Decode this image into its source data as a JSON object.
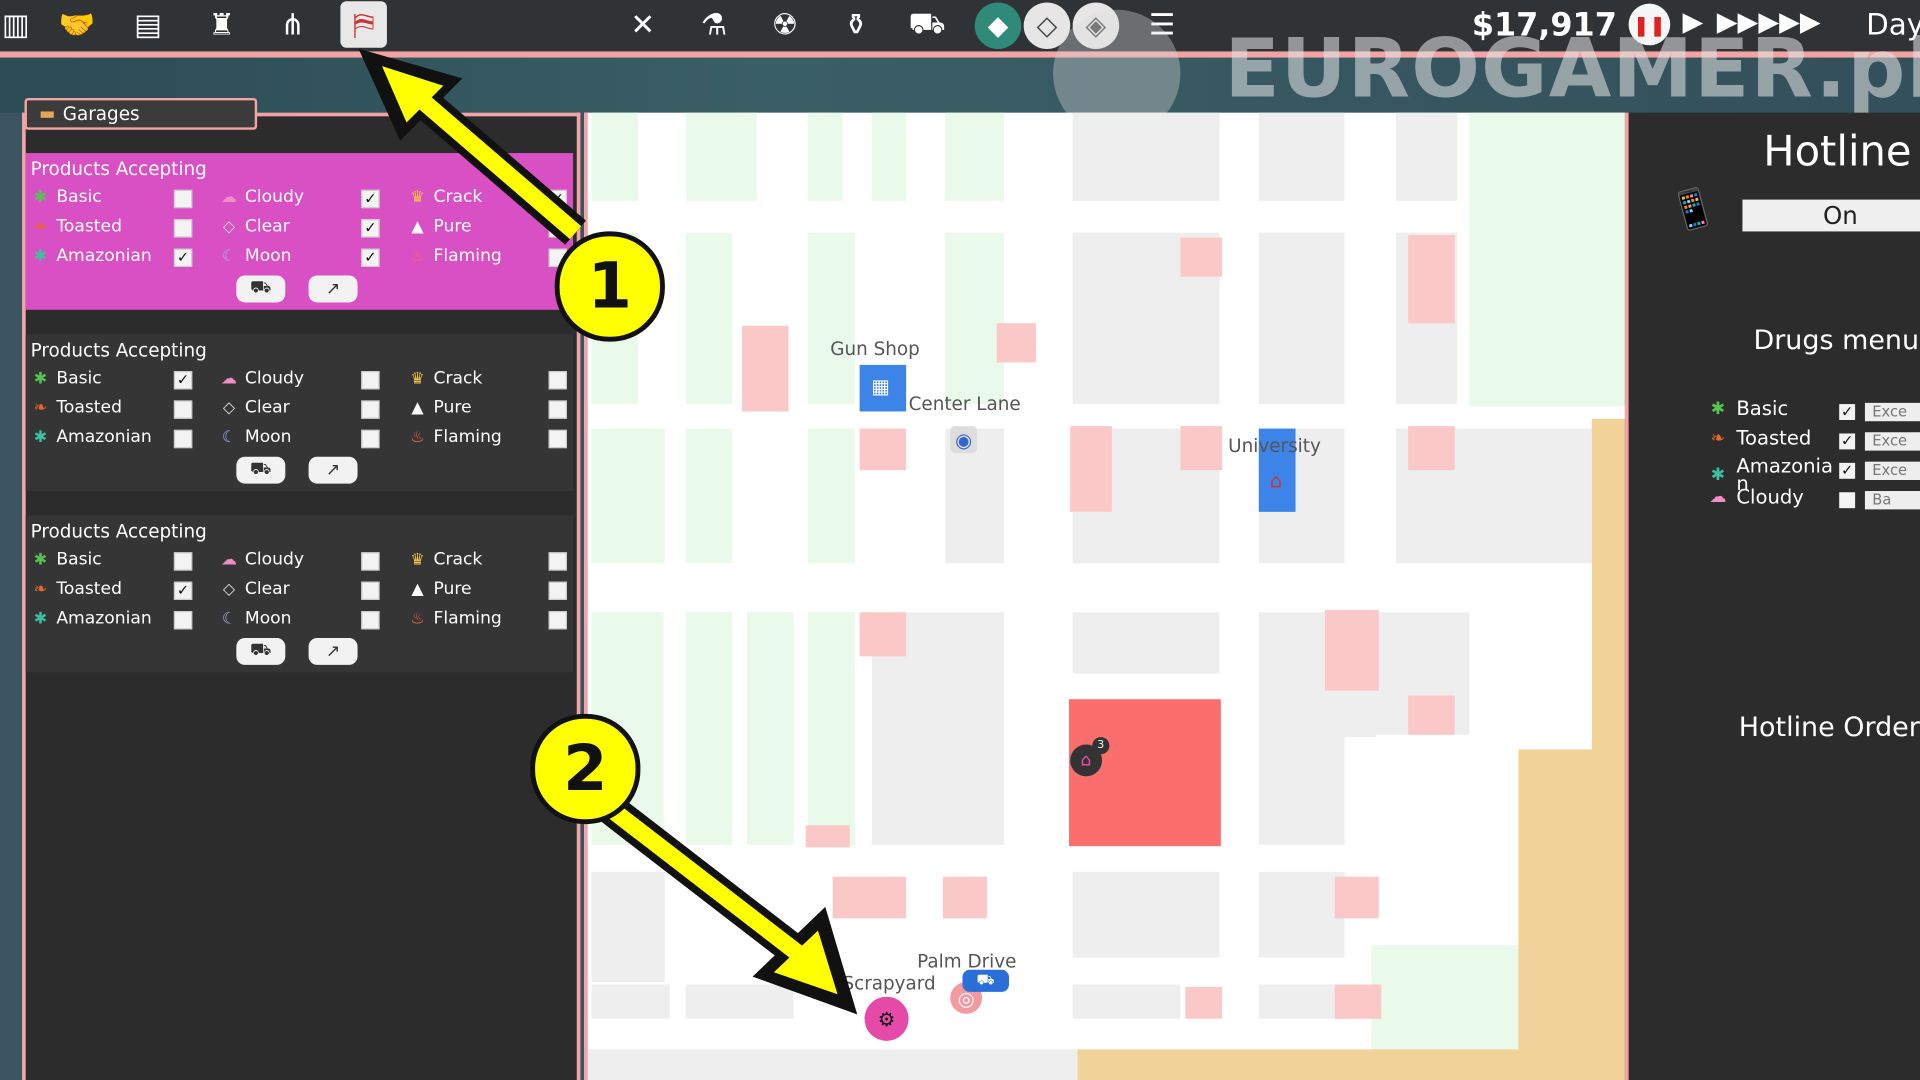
{
  "toolbar": {
    "money": "$17,917",
    "day_label": "Day",
    "left_icons": [
      "buildings-icon",
      "handshake-icon",
      "dealer-icon",
      "radio-tower-icon",
      "hierarchy-icon",
      "map-icon"
    ],
    "center_icons": [
      "crossed-tools-icon",
      "lab-flask-icon",
      "radiation-icon",
      "distillery-icon",
      "box-truck-icon",
      "layers-icon"
    ]
  },
  "watermark": {
    "text": "EUROGAMER.pl"
  },
  "garages": {
    "tab_label": "Garages",
    "sections": [
      {
        "title": "Products Accepting",
        "selected": true,
        "items": [
          {
            "label": "Basic",
            "checked": false
          },
          {
            "label": "Toasted",
            "checked": false
          },
          {
            "label": "Amazonian",
            "checked": true
          },
          {
            "label": "Cloudy",
            "checked": true
          },
          {
            "label": "Clear",
            "checked": true
          },
          {
            "label": "Moon",
            "checked": true
          },
          {
            "label": "Crack",
            "checked": true
          },
          {
            "label": "Pure",
            "checked": false
          },
          {
            "label": "Flaming",
            "checked": false
          }
        ]
      },
      {
        "title": "Products Accepting",
        "selected": false,
        "items": [
          {
            "label": "Basic",
            "checked": true
          },
          {
            "label": "Toasted",
            "checked": false
          },
          {
            "label": "Amazonian",
            "checked": false
          },
          {
            "label": "Cloudy",
            "checked": false
          },
          {
            "label": "Clear",
            "checked": false
          },
          {
            "label": "Moon",
            "checked": false
          },
          {
            "label": "Crack",
            "checked": false
          },
          {
            "label": "Pure",
            "checked": false
          },
          {
            "label": "Flaming",
            "checked": false
          }
        ]
      },
      {
        "title": "Products Accepting",
        "selected": false,
        "items": [
          {
            "label": "Basic",
            "checked": false
          },
          {
            "label": "Toasted",
            "checked": true
          },
          {
            "label": "Amazonian",
            "checked": false
          },
          {
            "label": "Cloudy",
            "checked": false
          },
          {
            "label": "Clear",
            "checked": false
          },
          {
            "label": "Moon",
            "checked": false
          },
          {
            "label": "Crack",
            "checked": false
          },
          {
            "label": "Pure",
            "checked": false
          },
          {
            "label": "Flaming",
            "checked": false
          }
        ]
      }
    ]
  },
  "map": {
    "labels": {
      "gun_shop": "Gun Shop",
      "center_lane": "Center Lane",
      "university": "University",
      "palm_drive": "Palm Drive",
      "scrapyard": "Scrapyard"
    },
    "house_badge": "3"
  },
  "hotline": {
    "title": "Hotline",
    "toggle": "On",
    "drugs_menu_title": "Drugs menu",
    "drugs": [
      {
        "label": "Basic",
        "checked": true,
        "select": "Exce"
      },
      {
        "label": "Toasted",
        "checked": true,
        "select": "Exce"
      },
      {
        "label": "Amazonia\nn",
        "checked": true,
        "select": "Exce"
      },
      {
        "label": "Cloudy",
        "checked": false,
        "select": "Ba"
      }
    ],
    "orders_title": "Hotline Orders"
  },
  "annotations": {
    "badge_1": "1",
    "badge_2": "2"
  },
  "colors": {
    "accent_pink": "#f2a4a4",
    "selected_garage": "#d94fc4",
    "annotation_yellow": "#ffff00"
  }
}
